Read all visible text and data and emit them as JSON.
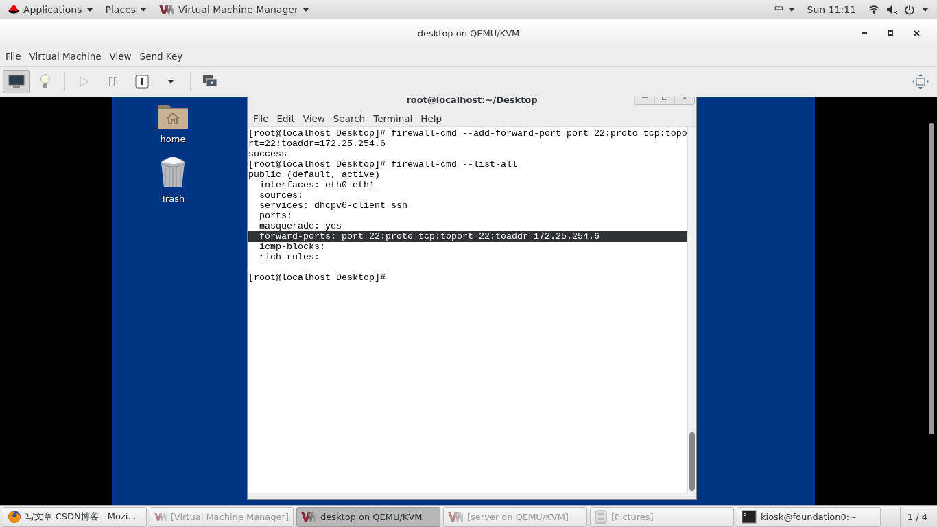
{
  "top_bar": {
    "applications": "Applications",
    "places": "Places",
    "app_menu": "Virtual Machine Manager",
    "input_method": "中",
    "clock": "Sun 11:11"
  },
  "window": {
    "title": "desktop on QEMU/KVM"
  },
  "menu": [
    "File",
    "Virtual Machine",
    "View",
    "Send Key"
  ],
  "toolbar": {
    "console_selected": true
  },
  "desktop_icons": [
    {
      "kind": "folder",
      "label": "home"
    },
    {
      "kind": "trash",
      "label": "Trash"
    }
  ],
  "terminal": {
    "title": "root@localhost:~/Desktop",
    "menu": [
      "File",
      "Edit",
      "View",
      "Search",
      "Terminal",
      "Help"
    ],
    "lines": [
      {
        "text": "[root@localhost Desktop]# firewall-cmd --add-forward-port=port=22:proto=tcp:topo",
        "selected": false
      },
      {
        "text": "rt=22:toaddr=172.25.254.6",
        "selected": false
      },
      {
        "text": "success",
        "selected": false
      },
      {
        "text": "[root@localhost Desktop]# firewall-cmd --list-all",
        "selected": false
      },
      {
        "text": "public (default, active)",
        "selected": false
      },
      {
        "text": "  interfaces: eth0 eth1",
        "selected": false
      },
      {
        "text": "  sources: ",
        "selected": false
      },
      {
        "text": "  services: dhcpv6-client ssh",
        "selected": false
      },
      {
        "text": "  ports: ",
        "selected": false
      },
      {
        "text": "  masquerade: yes",
        "selected": false
      },
      {
        "text": "  forward-ports: port=22:proto=tcp:toport=22:toaddr=172.25.254.6",
        "selected": true
      },
      {
        "text": "  icmp-blocks: ",
        "selected": false
      },
      {
        "text": "  rich rules: ",
        "selected": false
      },
      {
        "selected": false
      },
      {
        "text": "[root@localhost Desktop]# ",
        "selected": false
      }
    ]
  },
  "taskbar": [
    {
      "kind": "firefox",
      "label": "写文章-CSDN博客 - Mozi...",
      "selected": false
    },
    {
      "kind": "vm",
      "label": "[Virtual Machine Manager]",
      "selected": false
    },
    {
      "kind": "vm",
      "label": "desktop on QEMU/KVM",
      "selected": true
    },
    {
      "kind": "vm",
      "label": "[server on QEMU/KVM]",
      "selected": false
    },
    {
      "kind": "files",
      "label": "[Pictures]",
      "selected": false
    },
    {
      "kind": "terminal",
      "label": "kiosk@foundation0:~",
      "selected": false
    }
  ],
  "workspace": "1 / 4"
}
